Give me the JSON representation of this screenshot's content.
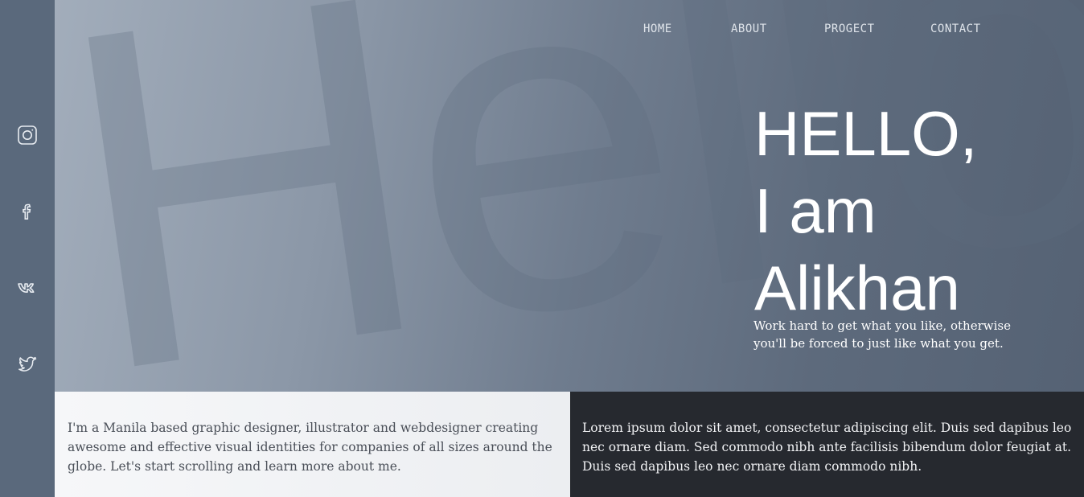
{
  "sidebar": {
    "icons": [
      "instagram-icon",
      "facebook-icon",
      "vk-icon",
      "twitter-icon"
    ]
  },
  "nav": {
    "items": [
      "HOME",
      "ABOUT",
      "PROGECT",
      "CONTACT"
    ]
  },
  "hero": {
    "background_word": "Hello",
    "greeting_line1": "HELLO,",
    "greeting_line2": "I am",
    "greeting_line3": "Alikhan",
    "tagline": "Work hard to get what you like, otherwise you'll be forced to just like what you get."
  },
  "about": {
    "left_text": "I'm a Manila based graphic designer, illustrator and webdesigner creating awesome and effective visual identities for companies of all sizes around the globe. Let's start scrolling and learn more about me.",
    "right_text": "Lorem ipsum dolor sit amet, consectetur adipiscing elit. Duis sed dapibus leo nec ornare diam. Sed commodo nibh ante facilisis bibendum dolor feugiat at. Duis sed dapibus leo nec ornare diam commodo nibh."
  },
  "colors": {
    "sidebar": "#5a697c",
    "dark_panel": "#26292f",
    "light_panel": "#f2f3f5"
  }
}
